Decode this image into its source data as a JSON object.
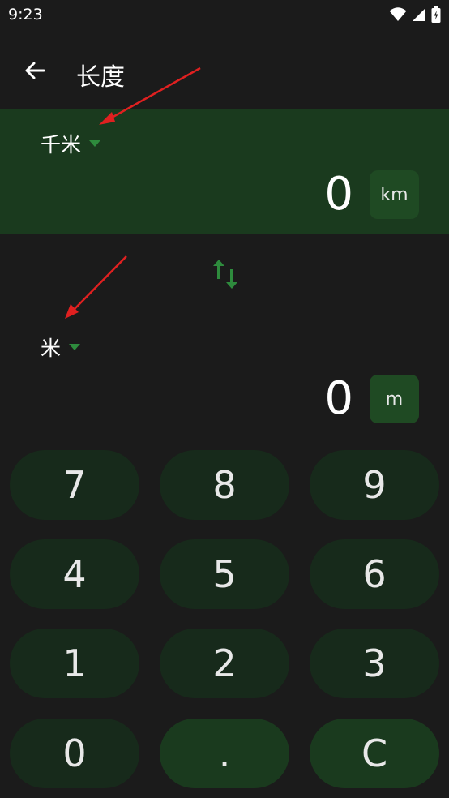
{
  "status_bar": {
    "time": "9:23"
  },
  "app_bar": {
    "title": "长度"
  },
  "from_unit": {
    "name": "千米",
    "value": "0",
    "symbol": "km"
  },
  "to_unit": {
    "name": "米",
    "value": "0",
    "symbol": "m"
  },
  "keypad": {
    "k7": "7",
    "k8": "8",
    "k9": "9",
    "k4": "4",
    "k5": "5",
    "k6": "6",
    "k1": "1",
    "k2": "2",
    "k3": "3",
    "k0": "0",
    "dot": ".",
    "clear": "C"
  },
  "colors": {
    "background": "#1b1b1b",
    "panel": "#1a3a1e",
    "key": "#172a1b",
    "accent": "#2e8b3d",
    "annotation_arrow": "#e02020"
  },
  "icons": [
    "wifi-icon",
    "signal-icon",
    "battery-icon",
    "back-arrow-icon",
    "swap-icon",
    "dropdown-caret-icon"
  ]
}
